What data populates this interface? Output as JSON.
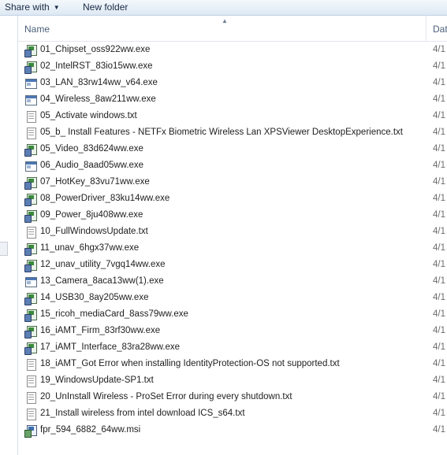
{
  "toolbar": {
    "share_with": "Share with",
    "new_folder": "New folder"
  },
  "columns": {
    "name": "Name",
    "date": "Dat"
  },
  "files": [
    {
      "name": "01_Chipset_oss922ww.exe",
      "date": "4/1",
      "icon": "setup-icon"
    },
    {
      "name": "02_IntelRST_83io15ww.exe",
      "date": "4/1",
      "icon": "setup-icon"
    },
    {
      "name": "03_LAN_83rw14ww_v64.exe",
      "date": "4/1",
      "icon": "application-icon"
    },
    {
      "name": "04_Wireless_8aw211ww.exe",
      "date": "4/1",
      "icon": "application-icon"
    },
    {
      "name": "05_Activate windows.txt",
      "date": "4/1",
      "icon": "text-file-icon"
    },
    {
      "name": "05_b_ Install Features - NETFx Biometric Wireless Lan XPSViewer DesktopExperience.txt",
      "date": "4/1",
      "icon": "text-file-icon"
    },
    {
      "name": "05_Video_83d624ww.exe",
      "date": "4/1",
      "icon": "setup-icon"
    },
    {
      "name": "06_Audio_8aad05ww.exe",
      "date": "4/1",
      "icon": "application-icon"
    },
    {
      "name": "07_HotKey_83vu71ww.exe",
      "date": "4/1",
      "icon": "setup-icon"
    },
    {
      "name": "08_PowerDriver_83ku14ww.exe",
      "date": "4/1",
      "icon": "setup-icon"
    },
    {
      "name": "09_Power_8ju408ww.exe",
      "date": "4/1",
      "icon": "setup-icon"
    },
    {
      "name": "10_FullWindowsUpdate.txt",
      "date": "4/1",
      "icon": "text-file-icon"
    },
    {
      "name": "11_unav_6hgx37ww.exe",
      "date": "4/1",
      "icon": "setup-icon"
    },
    {
      "name": "12_unav_utility_7vgq14ww.exe",
      "date": "4/1",
      "icon": "setup-icon"
    },
    {
      "name": "13_Camera_8aca13ww(1).exe",
      "date": "4/1",
      "icon": "application-icon"
    },
    {
      "name": "14_USB30_8ay205ww.exe",
      "date": "4/1",
      "icon": "setup-icon"
    },
    {
      "name": "15_ricoh_mediaCard_8ass79ww.exe",
      "date": "4/1",
      "icon": "setup-icon"
    },
    {
      "name": "16_iAMT_Firm_83rf30ww.exe",
      "date": "4/1",
      "icon": "setup-icon"
    },
    {
      "name": "17_iAMT_Interface_83ra28ww.exe",
      "date": "4/1",
      "icon": "setup-icon"
    },
    {
      "name": "18_iAMT_Got Error when installing IdentityProtection-OS not supported.txt",
      "date": "4/1",
      "icon": "text-file-icon"
    },
    {
      "name": "19_WindowsUpdate-SP1.txt",
      "date": "4/1",
      "icon": "text-file-icon"
    },
    {
      "name": "20_UnInstall Wireless - ProSet Error during every shutdown.txt",
      "date": "4/1",
      "icon": "text-file-icon"
    },
    {
      "name": "21_Install wireless from intel download ICS_s64.txt",
      "date": "4/1",
      "icon": "text-file-icon"
    },
    {
      "name": "fpr_594_6882_64ww.msi",
      "date": "4/1",
      "icon": "installer-package-icon"
    }
  ]
}
